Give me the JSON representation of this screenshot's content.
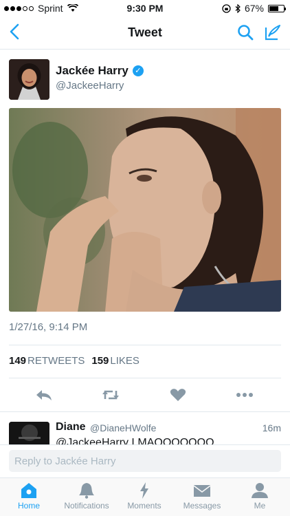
{
  "status_bar": {
    "carrier": "Sprint",
    "time": "9:30 PM",
    "battery": "67%",
    "battery_level": 0.67
  },
  "nav": {
    "title": "Tweet"
  },
  "tweet": {
    "author_name": "Jackée Harry",
    "author_handle": "@JackeeHarry",
    "timestamp": "1/27/16, 9:14 PM",
    "retweets_count": "149",
    "retweets_label": "RETWEETS",
    "likes_count": "159",
    "likes_label": "LIKES"
  },
  "reply_preview": {
    "name": "Diane",
    "handle": "@DianeHWolfe",
    "time": "16m",
    "text": "@JackeeHarry LMAOOOOOOO"
  },
  "reply_bar": {
    "placeholder": "Reply to Jackée Harry"
  },
  "tabs": [
    {
      "label": "Home",
      "icon": "home-icon"
    },
    {
      "label": "Notifications",
      "icon": "bell-icon"
    },
    {
      "label": "Moments",
      "icon": "lightning-icon"
    },
    {
      "label": "Messages",
      "icon": "envelope-icon"
    },
    {
      "label": "Me",
      "icon": "person-icon"
    }
  ],
  "colors": {
    "accent": "#1da1f2",
    "muted": "#657786"
  }
}
